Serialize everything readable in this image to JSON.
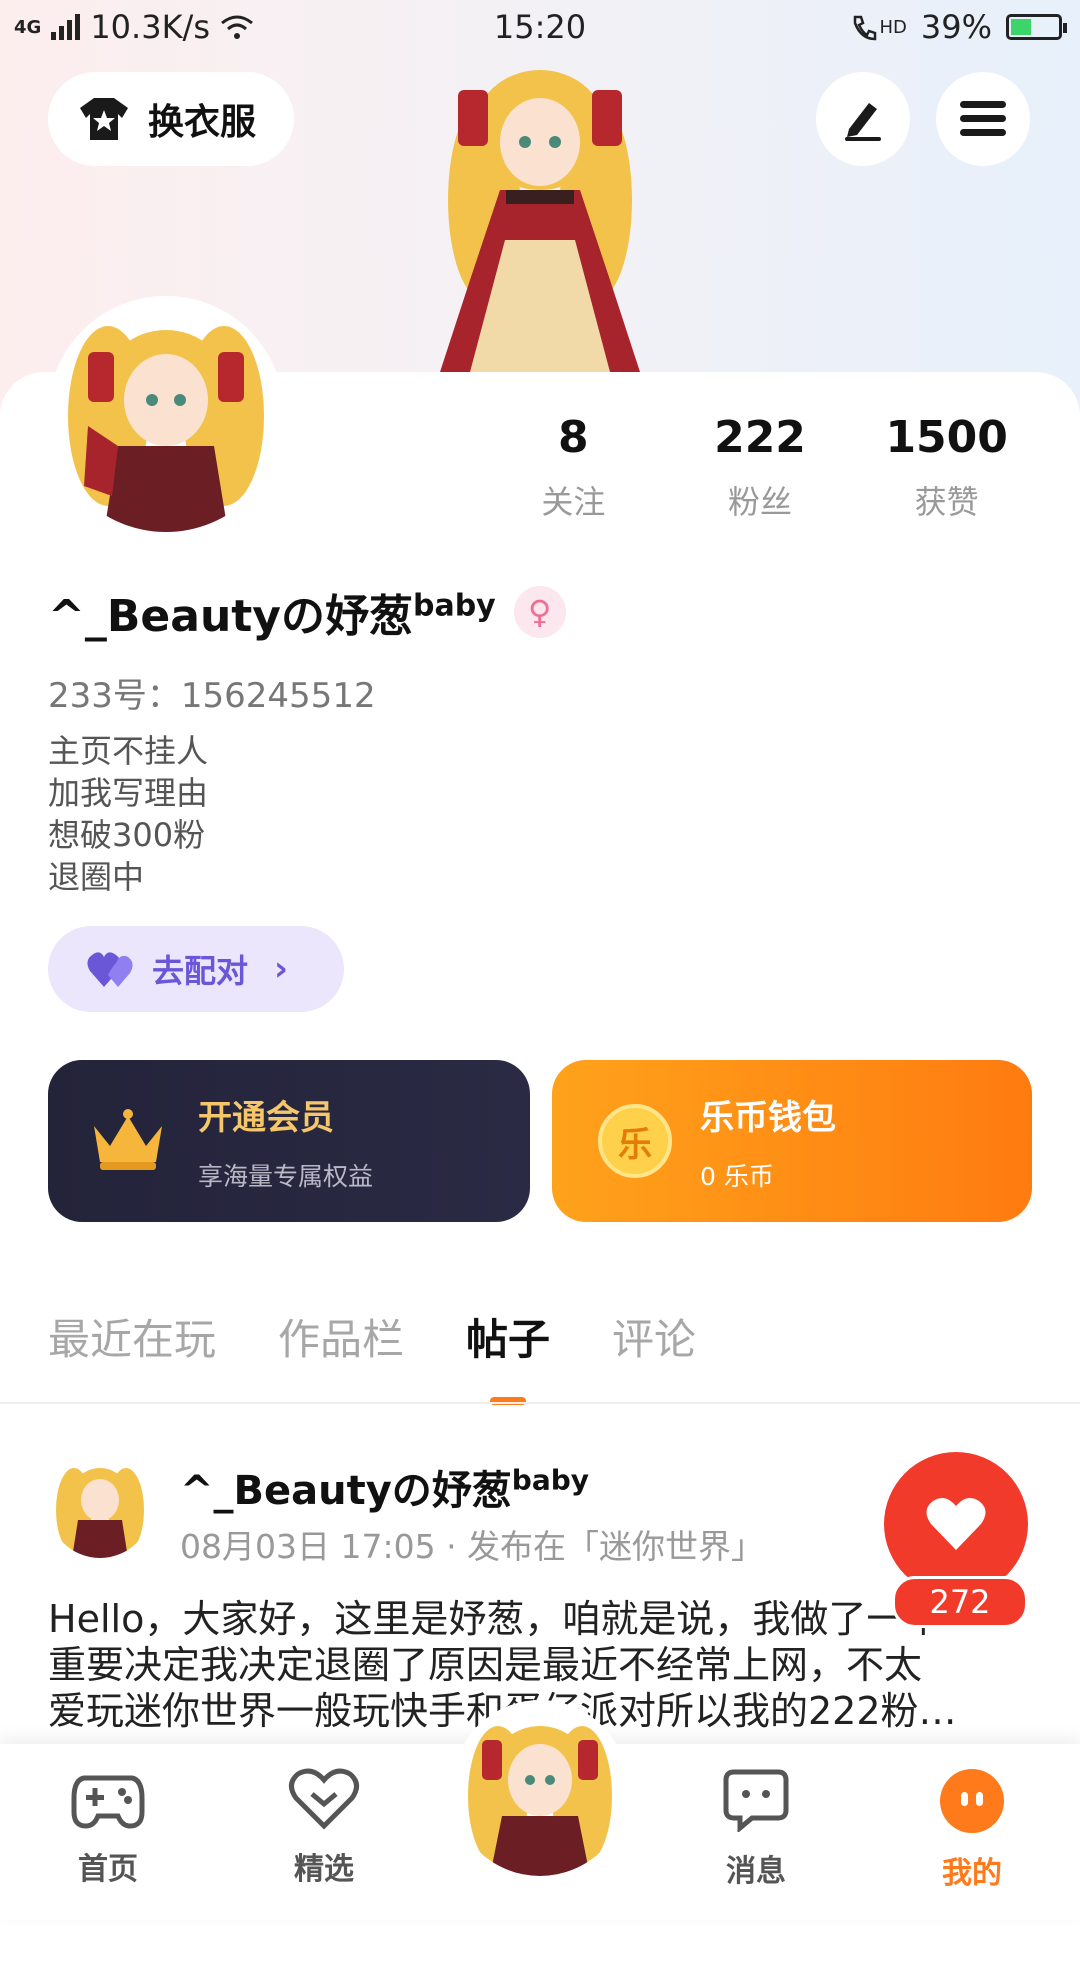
{
  "status_bar": {
    "network": "4G",
    "speed": "10.3K/s",
    "time": "15:20",
    "hd": "HD",
    "battery": "39%"
  },
  "header": {
    "outfit_label": "换衣服"
  },
  "profile": {
    "stats": [
      {
        "value": "8",
        "label": "关注"
      },
      {
        "value": "222",
        "label": "粉丝"
      },
      {
        "value": "1500",
        "label": "获赞"
      }
    ],
    "name": "^_Beautyの妤葱",
    "name_suffix": "baby",
    "gender_symbol": "♀",
    "uid": "233号：156245512",
    "bio": [
      "主页不挂人",
      "加我写理由",
      "想破300粉",
      "退圈中"
    ],
    "match_label": "去配对"
  },
  "promos": {
    "vip": {
      "title": "开通会员",
      "subtitle": "享海量专属权益"
    },
    "wallet": {
      "title": "乐币钱包",
      "subtitle": "0 乐币",
      "coin_char": "乐"
    }
  },
  "tabs": [
    {
      "label": "最近在玩",
      "active": false
    },
    {
      "label": "作品栏",
      "active": false
    },
    {
      "label": "帖子",
      "active": true
    },
    {
      "label": "评论",
      "active": false
    }
  ],
  "post": {
    "author": "^_Beautyの妤葱",
    "author_suffix": "baby",
    "meta": "08月03日 17:05 · 发布在「迷你世界」",
    "body_lines": [
      "Hello，大家好，这里是妤葱，咱就是说，我做了一个",
      "重要决定我决定退圈了原因是最近不经常上网，不太",
      "爱玩迷你世界一般玩快手和蛋仔派对所以我的222粉…"
    ],
    "likes": "272"
  },
  "nav": [
    {
      "label": "首页",
      "icon": "gamepad-icon"
    },
    {
      "label": "精选",
      "icon": "heart-outline-icon"
    },
    {
      "label": "消息",
      "icon": "chat-bubble-icon"
    },
    {
      "label": "我的",
      "icon": "face-icon",
      "active": true
    }
  ],
  "colors": {
    "accent_orange": "#ff7a1a",
    "like_red": "#f23a2a",
    "match_purple": "#6a57d8",
    "vip_dark": "#23233a"
  }
}
